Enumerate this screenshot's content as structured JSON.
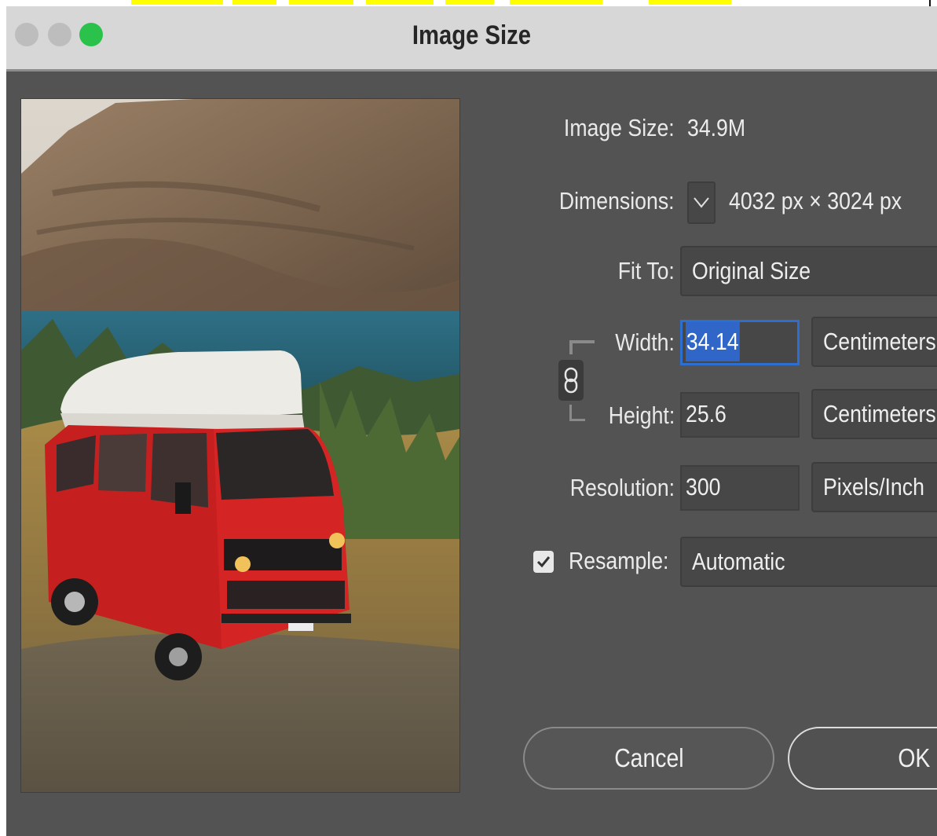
{
  "window": {
    "title": "Image Size",
    "traffic_lights": [
      "close",
      "minimize",
      "zoom"
    ]
  },
  "info": {
    "image_size_label": "Image Size:",
    "image_size_value": "34.9M",
    "dimensions_label": "Dimensions:",
    "dimensions_value": "4032 px  ×  3024 px"
  },
  "fit_to": {
    "label": "Fit To:",
    "value": "Original Size"
  },
  "width": {
    "label": "Width:",
    "value": "34.14",
    "unit": "Centimeters"
  },
  "height": {
    "label": "Height:",
    "value": "25.6",
    "unit": "Centimeters"
  },
  "resolution": {
    "label": "Resolution:",
    "value": "300",
    "unit": "Pixels/Inch"
  },
  "resample": {
    "label": "Resample:",
    "checked": true,
    "value": "Automatic"
  },
  "buttons": {
    "cancel": "Cancel",
    "ok": "OK"
  },
  "colors": {
    "dialog_bg": "#535353",
    "titlebar_bg": "#d7d7d7",
    "focus_ring": "#2d6fd0",
    "selection": "#2f66c7",
    "zoom_light": "#2ac24a"
  },
  "icons": {
    "dimensions_toggle": "chevron-down-icon",
    "constrain": "link-chain-icon",
    "resample_check": "checkmark-icon"
  }
}
